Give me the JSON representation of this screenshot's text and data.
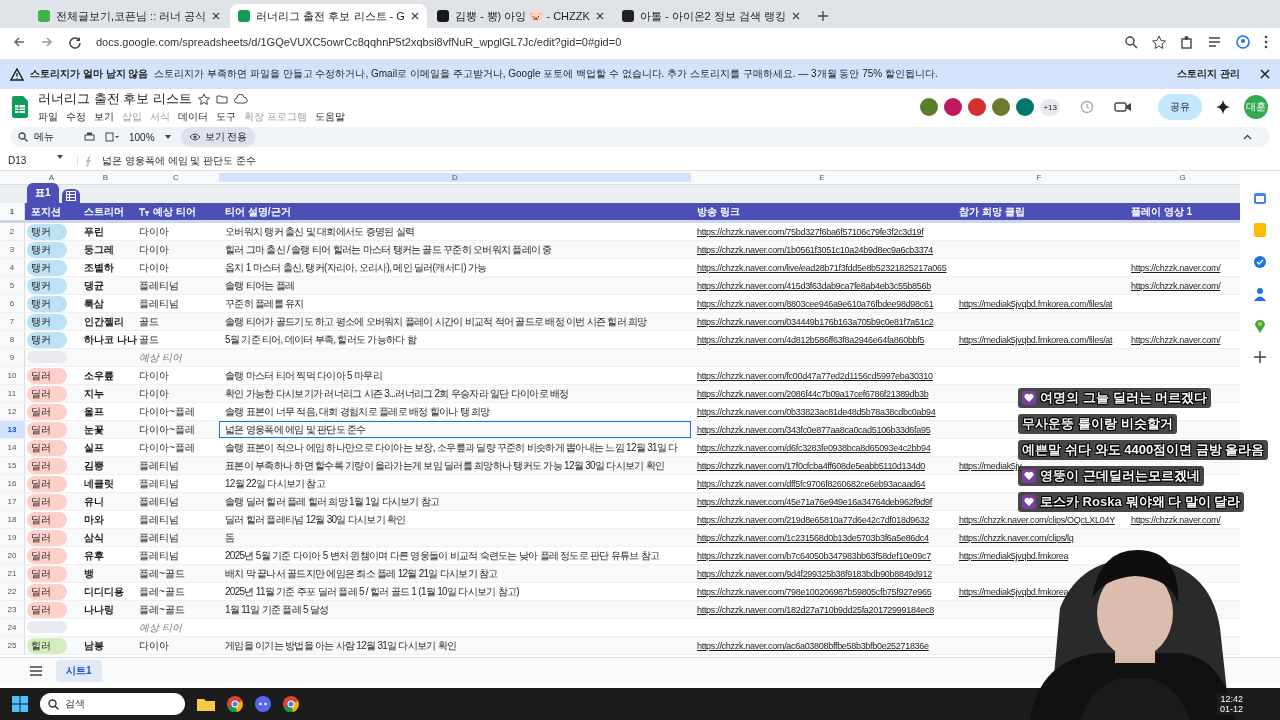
{
  "browser": {
    "tabs": [
      {
        "title": "전체글보기,코픈님 :: 러너 공식",
        "selected": false,
        "color": "#3bb54a"
      },
      {
        "title": "러너리그 출전 후보 리스트 - G",
        "selected": true,
        "color": "#0f9d58"
      },
      {
        "title": "김뿡 - 뿡) 아잉 🐷 - CHZZK",
        "selected": false,
        "color": "#1a1a1a"
      },
      {
        "title": "아톨 - 아이온2 정보 검색 랭킹",
        "selected": false,
        "color": "#222222"
      }
    ],
    "address": "docs.google.com/spreadsheets/d/1GQeVUXC5owrCc8qqhnP5t2xqbsi8vfNuR_wpglGL7Jc/edit?gid=0#gid=0"
  },
  "banner": {
    "title": "스토리지가 얼마 남지 않음",
    "message": "스토리지가 부족하면 파일을 만들고 수정하거나, Gmail로 이메일을 주고받거나, Google 포토에 백업할 수 없습니다. 추가 스토리지를 구매하세요. — 3개월 동안 75% 할인됩니다.",
    "action": "스토리지 관리"
  },
  "document": {
    "title": "러너리그 출전 후보 리스트",
    "menus": [
      {
        "label": "파일",
        "disabled": false
      },
      {
        "label": "수정",
        "disabled": false
      },
      {
        "label": "보기",
        "disabled": false
      },
      {
        "label": "삽입",
        "disabled": true
      },
      {
        "label": "서식",
        "disabled": true
      },
      {
        "label": "데이터",
        "disabled": false
      },
      {
        "label": "도구",
        "disabled": false
      },
      {
        "label": "확장 프로그램",
        "disabled": true
      },
      {
        "label": "도움말",
        "disabled": false
      }
    ],
    "collaborators": [
      {
        "color": "#5a7d2a"
      },
      {
        "color": "#c2185b"
      },
      {
        "color": "#d32f2f"
      },
      {
        "color": "#6d7a2e"
      },
      {
        "color": "#00796b"
      }
    ],
    "more_collaborators": "+13",
    "share": "공유",
    "account": "대훈"
  },
  "toolbar": {
    "search": "메뉴",
    "zoom": "100%",
    "mode": "보기 전용"
  },
  "formula_bar": {
    "cell": "D13",
    "value": "넓은 영웅폭에 에임 및 판단도 준수"
  },
  "sheet": {
    "columns": [
      "A",
      "B",
      "C",
      "D",
      "E",
      "F",
      "G"
    ],
    "table_name": "표1",
    "header_number": "1",
    "header": [
      "포지션",
      "스트리머",
      "예상 티어",
      "티어 설명/근거",
      "방송 링크",
      "참가 희망 클립",
      "플레이 영상 1"
    ],
    "rows": [
      {
        "kind": "entry",
        "number": "2",
        "selected": false,
        "position": {
          "label": "탱커",
          "color": "#bfe1f6"
        },
        "streamer": "푸린",
        "tier": "다이아",
        "note": "오버워치 랭커 출신 및 대회에서도 증명된 실력",
        "link": "https://chzzk.naver.com/75bd327f6ba6f57106c79fe3f2c3d19f"
      },
      {
        "kind": "entry",
        "number": "3",
        "selected": false,
        "position": {
          "label": "탱커",
          "color": "#bfe1f6"
        },
        "streamer": "둥그레",
        "tier": "다이아",
        "note": "힐러 그마 출신 / 솔랭 티어 힐러는 마스터 탱커는 골드 꾸준히 오버워치 플레이 중",
        "link": "https://chzzk.naver.com/1b0561f3051c10a24b9d8ec9a6cb3374"
      },
      {
        "kind": "entry",
        "number": "4",
        "selected": false,
        "position": {
          "label": "탱커",
          "color": "#bfe1f6"
        },
        "streamer": "조별하",
        "tier": "다이아",
        "note": "옵치 1 마스터 출신, 탱커(자리아, 오리사), 메인 딜러(캐서디) 가능",
        "link": "https://chzzk.naver.com/live/ead28b71f3fdd5e8b52321825217a065",
        "video": "https://chzzk.naver.com/"
      },
      {
        "kind": "entry",
        "number": "5",
        "selected": false,
        "position": {
          "label": "탱커",
          "color": "#bfe1f6"
        },
        "streamer": "댕균",
        "tier": "플레티넘",
        "note": "솔랭 티어는 플레",
        "link": "https://chzzk.naver.com/415d3f63dab9ca7fe8ab4eb3c55b856b",
        "video": "https://chzzk.naver.com/"
      },
      {
        "kind": "entry",
        "number": "6",
        "selected": false,
        "position": {
          "label": "탱커",
          "color": "#bfe1f6"
        },
        "streamer": "룩삼",
        "tier": "플레티넘",
        "note": "꾸준히 플레를 유지",
        "link": "https://chzzk.naver.com/8803cee946a9e610a76fbdee98d98c61",
        "clip": "https://mediak5jvqbd.fmkorea.com/files/at"
      },
      {
        "kind": "entry",
        "number": "7",
        "selected": false,
        "position": {
          "label": "탱커",
          "color": "#bfe1f6"
        },
        "streamer": "인간젤리",
        "tier": "골드",
        "note": "솔랭 티어가 골드기도 하고 평소에 오버워치 플레이 시간이 비교적 적어 골드로 배정 이번 시즌 힐러 희망",
        "link": "https://chzzk.naver.com/034449b176b163a705b9c0e81f7a51c2"
      },
      {
        "kind": "entry",
        "number": "8",
        "selected": false,
        "position": {
          "label": "탱커",
          "color": "#bfe1f6"
        },
        "streamer": "하나코 나나",
        "tier": "골드",
        "note": "5월 기준 티어, 데이터 부족, 힐러도 가능하다 함",
        "link": "https://chzzk.naver.com/4d812b586ff63f8a2946e64fa860bbf5",
        "clip": "https://mediak5jvqbd.fmkorea.com/files/at",
        "video": "https://chzzk.naver.com/"
      },
      {
        "kind": "group",
        "number": "9",
        "selected": false,
        "label": "예상 티어"
      },
      {
        "kind": "entry",
        "number": "10",
        "selected": false,
        "position": {
          "label": "딜러",
          "color": "#ffcfc9"
        },
        "streamer": "소우릎",
        "tier": "다이아",
        "note": "솔랭 마스터 티어 찍먹 다이아 5 마무리",
        "link": "https://chzzk.naver.com/fc00d47a77ed2d1156cd5997eba30310"
      },
      {
        "kind": "entry",
        "number": "11",
        "selected": false,
        "position": {
          "label": "딜러",
          "color": "#ffcfc9"
        },
        "streamer": "지누",
        "tier": "다이아",
        "note": "확인 가능한 다시보기가 러너리그 시즌 3...러너리그 2회 우승자라 일단 다이아로 배정",
        "link": "https://chzzk.naver.com/2086f44c7b09a17cef6786f21389db3b"
      },
      {
        "kind": "entry",
        "number": "12",
        "selected": false,
        "position": {
          "label": "딜러",
          "color": "#ffcfc9"
        },
        "streamer": "울프",
        "tier": "다이아~플레",
        "note": "솔랭 표본이 너무 적음, 대회 경험치로 플레로 배정 힐이나 탱 희망",
        "link": "https://chzzk.naver.com/0b33823ac81de48d5b78a38cdbc0ab94"
      },
      {
        "kind": "entry",
        "number": "13",
        "selected": true,
        "position": {
          "label": "딜러",
          "color": "#ffcfc9"
        },
        "streamer": "눈꽃",
        "tier": "다이아~플레",
        "note": "넓은 영웅폭에 에임 및 판단도 준수",
        "link": "https://chzzk.naver.com/343fc0e877aa8ca0cad5106b33d6fa95"
      },
      {
        "kind": "entry",
        "number": "14",
        "selected": false,
        "position": {
          "label": "딜러",
          "color": "#ffcfc9"
        },
        "streamer": "실프",
        "tier": "다이아~플레",
        "note": "솔랭 표본이 적으나 에임 하나만으로 다이아는 보장, 소우릎과 딜량 꾸준히 비슷하게 뽑아내는 느낌 12월 31일 다",
        "link": "https://chzzk.naver.com/d6fc3283fe0938bca8d65093e4c2bb94"
      },
      {
        "kind": "entry",
        "number": "15",
        "selected": false,
        "position": {
          "label": "딜러",
          "color": "#ffcfc9"
        },
        "streamer": "김뿡",
        "tier": "플레티넘",
        "note": "표본이 부족하나 하면 할수록 기량이 올라가는게 보임 딜러를 희망하나 탱커도 가능  12월 30일 다시보기 확인",
        "link": "https://chzzk.naver.com/17f0cfcba4ff608de5eabb5110d134d0",
        "clip": "https://mediak5jv"
      },
      {
        "kind": "entry",
        "number": "16",
        "selected": false,
        "position": {
          "label": "딜러",
          "color": "#ffcfc9"
        },
        "streamer": "네클릿",
        "tier": "플레티넘",
        "note": "12월 22일 다시보기 참고",
        "link": "https://chzzk.naver.com/dff5fc9706f8260682ce6eb93acaad64"
      },
      {
        "kind": "entry",
        "number": "17",
        "selected": false,
        "position": {
          "label": "딜러",
          "color": "#ffcfc9"
        },
        "streamer": "유니",
        "tier": "플레티넘",
        "note": "솔랭 딜러 힐러 플레 힐러 희망 1월 1일 다시보기 참고",
        "link": "https://chzzk.naver.com/45e71a76e949e16a34764deb962f9d9f"
      },
      {
        "kind": "entry",
        "number": "18",
        "selected": false,
        "position": {
          "label": "딜러",
          "color": "#ffcfc9"
        },
        "streamer": "마와",
        "tier": "플레티넘",
        "note": "딜러 힐러 플레티넘 12월 30일 다시보기 확인",
        "link": "https://chzzk.naver.com/219d8e65810a77d6e42c7df018d9632",
        "clip": "https://chzzk.naver.com/clips/OQcLXL04Y",
        "video": "https://chzzk.naver.com/"
      },
      {
        "kind": "entry",
        "number": "19",
        "selected": false,
        "position": {
          "label": "딜러",
          "color": "#ffcfc9"
        },
        "streamer": "삼식",
        "tier": "플레티넘",
        "note": "돔",
        "link": "https://chzzk.naver.com/1c231568d0b13de5703b3f6a5e86dc4",
        "clip": "https://chzzk.naver.com/clips/lq"
      },
      {
        "kind": "entry",
        "number": "20",
        "selected": false,
        "position": {
          "label": "딜러",
          "color": "#ffcfc9"
        },
        "streamer": "유후",
        "tier": "플레티넘",
        "note": "2025년 5월 기준 다이아 5 변처 윈챔이며 다른 영웅들이 비교적 숙련도는 낮아 플레 정도로 판단 유튜브 참고",
        "link": "https://chzzk.naver.com/b7c64050b347983bb63f58def10e09c7",
        "clip": "https://mediak5jvqbd.fmkorea"
      },
      {
        "kind": "entry",
        "number": "21",
        "selected": false,
        "position": {
          "label": "딜러",
          "color": "#ffcfc9"
        },
        "streamer": "뱅",
        "tier": "플레~골드",
        "note": "배치 막 끝나서 골드지만 에임은 최소 플레 12월 21일 다시보기 참고",
        "link": "https://chzzk.naver.com/9d4f299325b38f9183bdb90b8849d912"
      },
      {
        "kind": "entry",
        "number": "22",
        "selected": false,
        "position": {
          "label": "딜러",
          "color": "#ffcfc9"
        },
        "streamer": "디디디용",
        "tier": "플레~골드",
        "note": "2025년 11월 기준 주포 딜러 플레 5 / 힐러 골드 1 (1월 10일 다시보기 참고)",
        "link": "https://chzzk.naver.com/798e100206987b59805cfb75f927e965",
        "clip": "https://mediak5jvqbd.fmkorea"
      },
      {
        "kind": "entry",
        "number": "23",
        "selected": false,
        "position": {
          "label": "딜러",
          "color": "#ffcfc9"
        },
        "streamer": "나나링",
        "tier": "플레~골드",
        "note": "1월 11일 기준 플레 5 달성",
        "link": "https://chzzk.naver.com/182d27a710b9dd25fa20172999184ec8"
      },
      {
        "kind": "group",
        "number": "24",
        "selected": false,
        "label": "예상 티어"
      },
      {
        "kind": "entry",
        "number": "25",
        "selected": false,
        "position": {
          "label": "힐러",
          "color": "#d4edbc"
        },
        "streamer": "남봉",
        "tier": "다이아",
        "note": "게임을 이기는 방법을 아는 사람 12월 31일 다시보기 확인",
        "link": "https://chzzk.naver.com/ac6a03808bffbe58b3bfb0e25271836e"
      }
    ],
    "sheet_tabs": [
      {
        "label": "시트1",
        "selected": true
      }
    ]
  },
  "chat": [
    {
      "badge": true,
      "name": "여명의 그늘",
      "text": "딜러는 머르겠다"
    },
    {
      "badge": false,
      "name": "무사운뚱",
      "text": "률이랑 비슷할거"
    },
    {
      "badge": false,
      "name": "예쁜말",
      "text": "쉬다 와도 4400점이면 금방 올라옴"
    },
    {
      "badge": true,
      "name": "영뚱이",
      "text": "근데딜러는모르겠네"
    },
    {
      "badge": true,
      "name": "로스카 Roska",
      "text": "뭐야왜 다 말이 달라"
    }
  ],
  "taskbar": {
    "search": "검색",
    "time": "12:42",
    "date": "01-12"
  }
}
